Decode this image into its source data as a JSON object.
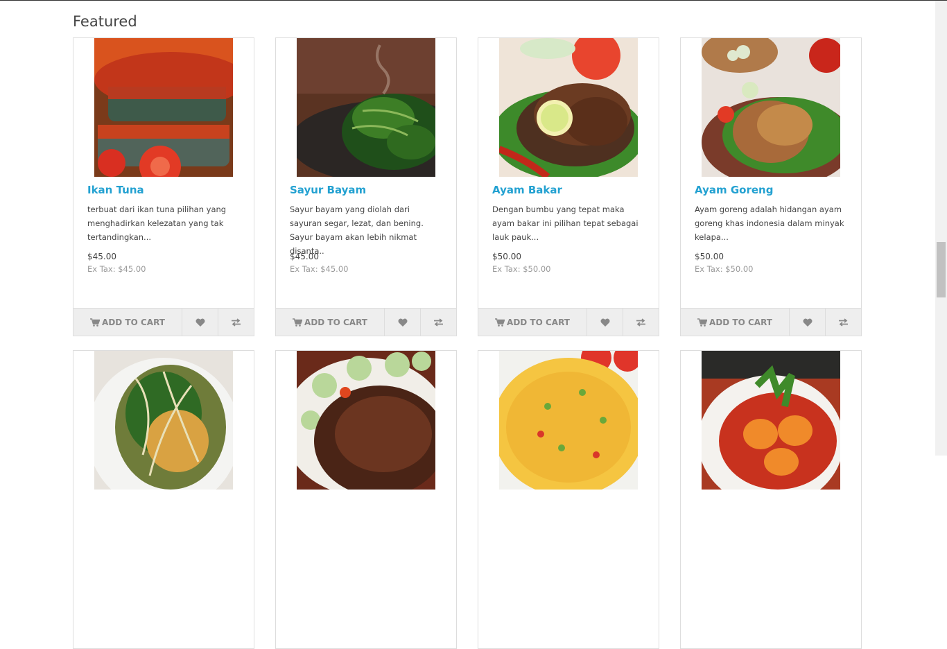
{
  "section": {
    "title": "Featured"
  },
  "products": [
    {
      "name": "Ikan Tuna",
      "desc": "terbuat dari ikan tuna pilihan yang menghadirkan kelezatan yang tak tertandingkan...",
      "price": "$45.00",
      "tax": "Ex Tax: $45.00",
      "cart_label": "ADD TO CART",
      "image": "grilled-tuna-with-sambal"
    },
    {
      "name": "Sayur Bayam",
      "desc": "Sayur bayam yang diolah dari sayuran segar, lezat, dan bening. Sayur bayam akan lebih nikmat disanta..",
      "price": "$45.00",
      "tax": "Ex Tax: $45.00",
      "cart_label": "ADD TO CART",
      "image": "stir-fried-spinach"
    },
    {
      "name": "Ayam Bakar",
      "desc": "Dengan bumbu yang tepat maka ayam bakar ini pilihan tepat sebagai lauk pauk...",
      "price": "$50.00",
      "tax": "Ex Tax: $50.00",
      "cart_label": "ADD TO CART",
      "image": "grilled-chicken"
    },
    {
      "name": "Ayam Goreng",
      "desc": "Ayam goreng adalah hidangan ayam goreng khas indonesia dalam minyak kelapa...",
      "price": "$50.00",
      "tax": "Ex Tax: $50.00",
      "cart_label": "ADD TO CART",
      "image": "fried-chicken"
    },
    {
      "image": "urap-vegetable-salad"
    },
    {
      "image": "fried-fish-with-cucumber"
    },
    {
      "image": "omelette"
    },
    {
      "image": "balado-eggs"
    }
  ],
  "icons": {
    "cart": "cart-icon",
    "wishlist": "heart-icon",
    "compare": "compare-arrows-icon"
  },
  "colors": {
    "accent": "#23a1d1",
    "button_bg": "#eeeeee",
    "button_text": "#888888"
  }
}
